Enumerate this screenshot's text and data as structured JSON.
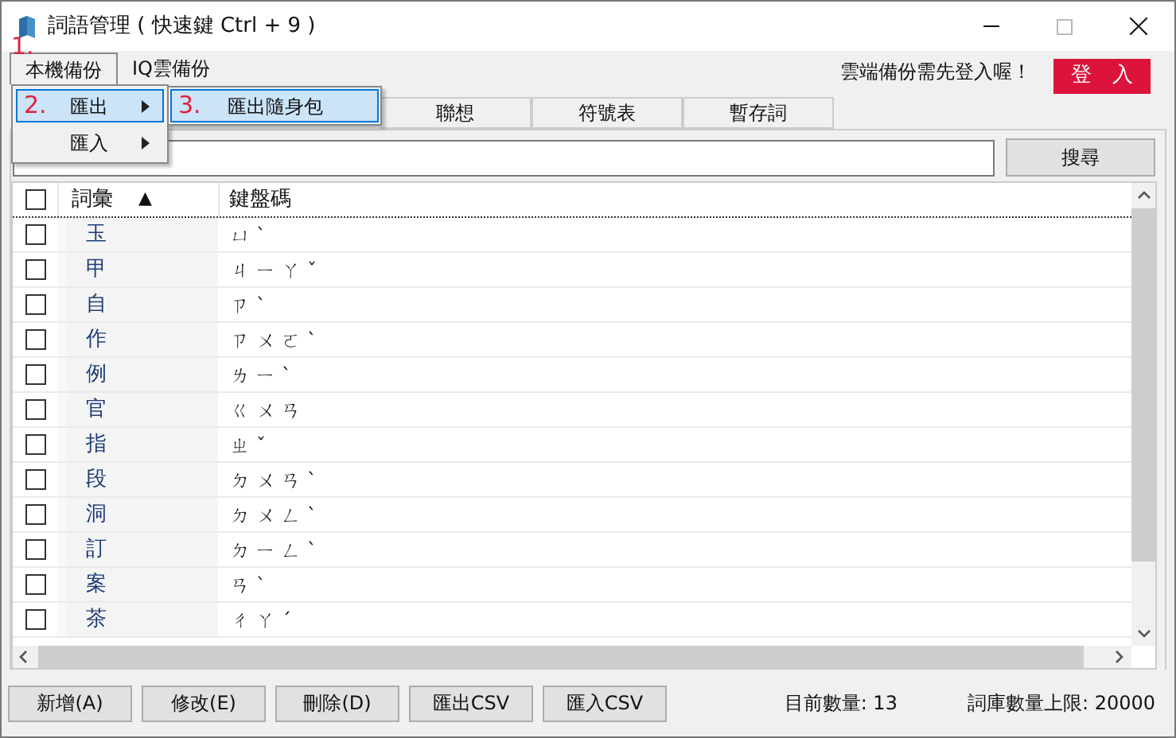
{
  "window": {
    "title": "詞語管理 ( 快速鍵 Ctrl + 9 )"
  },
  "menu_bar": {
    "items": [
      {
        "label": "本機備份",
        "selected": true
      },
      {
        "label": "IQ雲備份",
        "selected": false
      }
    ],
    "annotation": "1.",
    "notice": "雲端備份需先登入喔！",
    "login_button": "登　入"
  },
  "menu": {
    "items": [
      {
        "label": "匯出",
        "annotation": "2.",
        "selected": true,
        "has_submenu": true
      },
      {
        "label": "匯入",
        "selected": false,
        "has_submenu": true
      }
    ]
  },
  "submenu": {
    "items": [
      {
        "label": "匯出隨身包",
        "annotation": "3.",
        "selected": true
      }
    ]
  },
  "tabs": [
    {
      "label": "聯想",
      "selected": false
    },
    {
      "label": "符號表",
      "selected": false
    },
    {
      "label": "暫存詞",
      "selected": false
    }
  ],
  "search_button": "搜尋",
  "table": {
    "header_checked": false,
    "columns": [
      "詞彙",
      "鍵盤碼"
    ],
    "sort_indicator": "▲",
    "rows": [
      {
        "word": "玉",
        "code": "ㄩˋ",
        "checked": false
      },
      {
        "word": "甲",
        "code": "ㄐㄧㄚˇ",
        "checked": false
      },
      {
        "word": "自",
        "code": "ㄗˋ",
        "checked": false
      },
      {
        "word": "作",
        "code": "ㄗㄨㄛˋ",
        "checked": false
      },
      {
        "word": "例",
        "code": "ㄌㄧˋ",
        "checked": false
      },
      {
        "word": "官",
        "code": "ㄍㄨㄢ",
        "checked": false
      },
      {
        "word": "指",
        "code": "ㄓˇ",
        "checked": false
      },
      {
        "word": "段",
        "code": "ㄉㄨㄢˋ",
        "checked": false
      },
      {
        "word": "洞",
        "code": "ㄉㄨㄥˋ",
        "checked": false
      },
      {
        "word": "訂",
        "code": "ㄉㄧㄥˋ",
        "checked": false
      },
      {
        "word": "案",
        "code": "ㄢˋ",
        "checked": false
      },
      {
        "word": "茶",
        "code": "ㄔㄚˊ",
        "checked": false
      }
    ]
  },
  "buttons": [
    "新增(A)",
    "修改(E)",
    "刪除(D)",
    "匯出CSV",
    "匯入CSV"
  ],
  "status": {
    "count": "目前數量: 13",
    "limit": "詞庫數量上限: 20000"
  }
}
